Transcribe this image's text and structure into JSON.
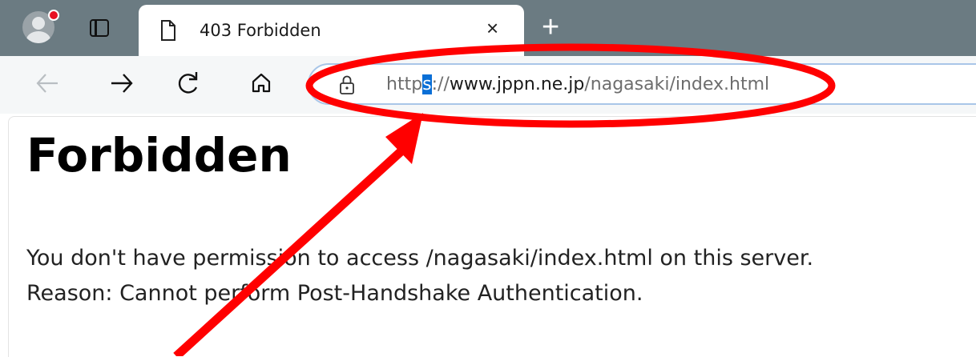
{
  "browser": {
    "tab": {
      "title": "403 Forbidden",
      "close_glyph": "×",
      "icon": "page-icon"
    },
    "new_tab_glyph": "+",
    "toolbar": {
      "back_glyph": "←",
      "forward_glyph": "→",
      "icons": [
        "back-icon",
        "forward-icon",
        "refresh-icon",
        "home-icon"
      ]
    },
    "address_bar": {
      "lock_icon": "lock-icon",
      "url_prefix": "http",
      "url_selected": "s",
      "url_scheme_sep": "://",
      "url_host": "www.jppn.ne.jp",
      "url_path": "/nagasaki/index.html"
    }
  },
  "page": {
    "heading": "Forbidden",
    "message_line1": "You don't have permission to access /nagasaki/index.html on this server.",
    "message_line2": "Reason: Cannot perform Post-Handshake Authentication."
  },
  "annotation": {
    "color": "#ff0000",
    "shapes": [
      "ellipse-around-url",
      "arrow-to-url-scheme"
    ]
  },
  "colors": {
    "tabstrip": "#6b7b82",
    "toolbar": "#f5f7f8",
    "selection": "#0a6fd6",
    "address_border": "#a9c6e8"
  }
}
